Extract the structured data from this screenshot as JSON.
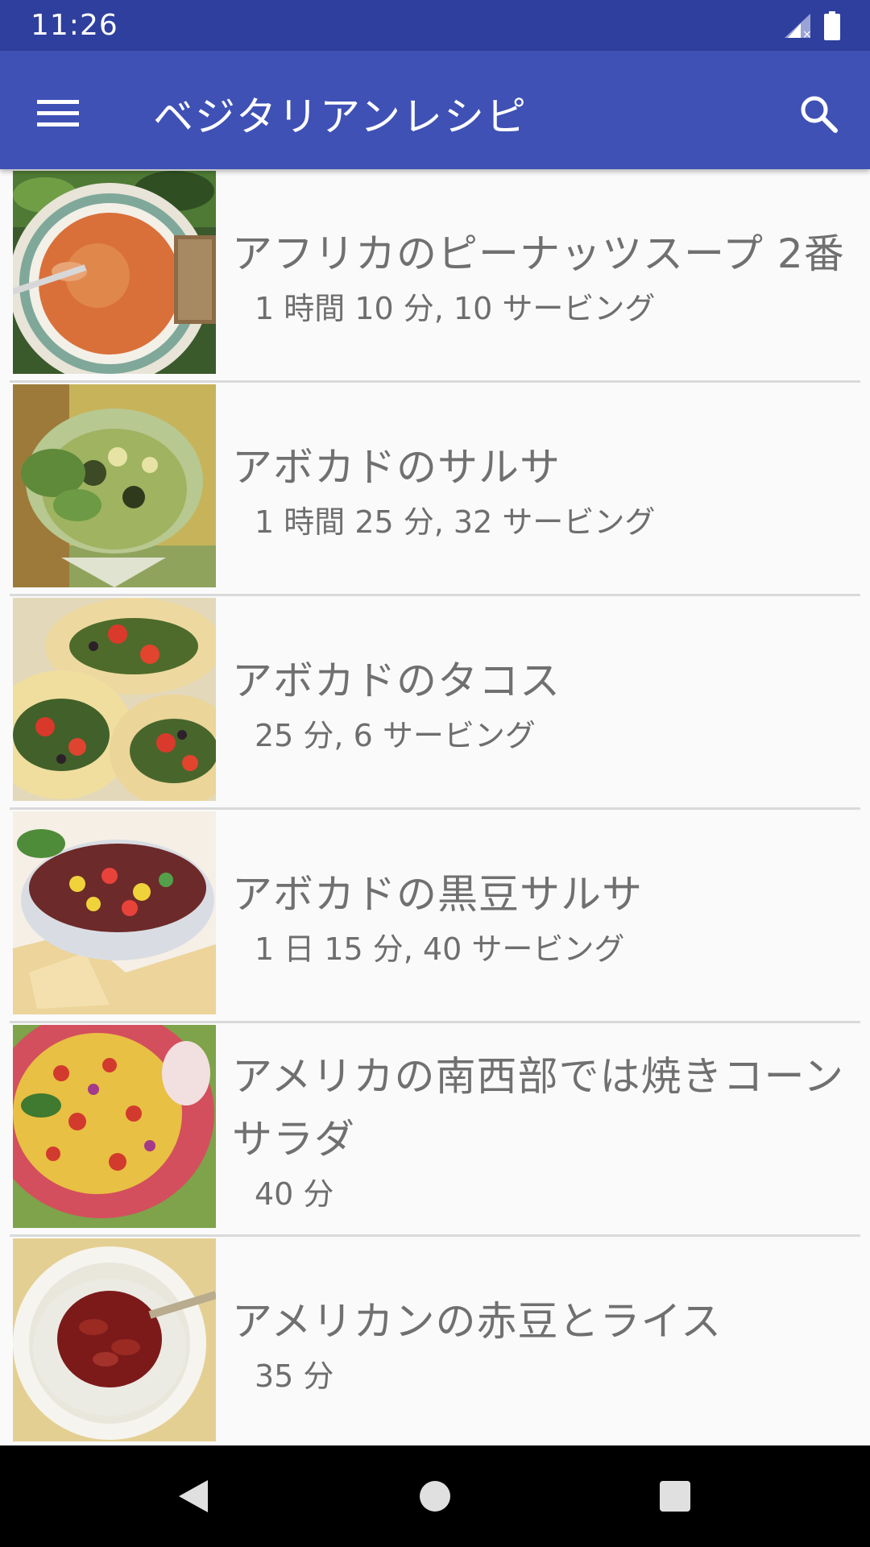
{
  "status_bar": {
    "time": "11:26",
    "icons": [
      "signal-icon",
      "battery-icon"
    ]
  },
  "app_bar": {
    "title": "ベジタリアンレシピ",
    "menu_icon": "menu-icon",
    "search_icon": "search-icon",
    "color": "#3f51b5",
    "status_color": "#2f3f9e"
  },
  "recipes": [
    {
      "title": "アフリカのピーナッツスープ 2番",
      "meta": "1 時間 10 分, 10 サービング"
    },
    {
      "title": "アボカドのサルサ",
      "meta": "1 時間 25 分, 32 サービング"
    },
    {
      "title": "アボカドのタコス",
      "meta": "25 分, 6 サービング"
    },
    {
      "title": "アボカドの黒豆サルサ",
      "meta": "1 日 15 分, 40 サービング"
    },
    {
      "title": "アメリカの南西部では焼きコーンサラダ",
      "meta": "40 分"
    },
    {
      "title": "アメリカンの赤豆とライス",
      "meta": "35 分"
    }
  ],
  "nav_bar": {
    "buttons": [
      "back-icon",
      "home-icon",
      "recents-icon"
    ]
  }
}
